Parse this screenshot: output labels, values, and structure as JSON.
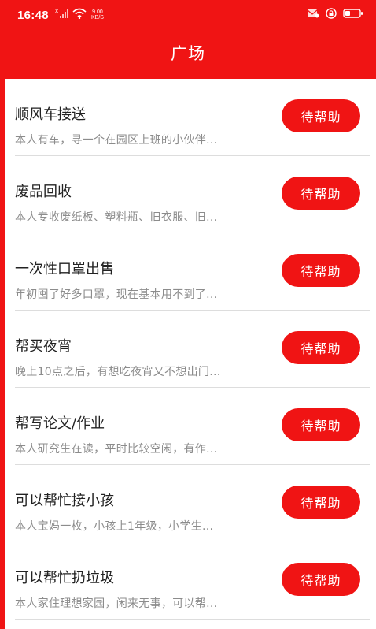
{
  "status_bar": {
    "time": "16:48",
    "net_speed_value": "9.00",
    "net_speed_unit": "KB/S",
    "icons": [
      "no-signal-icon",
      "wifi-icon",
      "mail-icon",
      "lock-icon",
      "battery-icon"
    ]
  },
  "header": {
    "title": "广场"
  },
  "colors": {
    "accent": "#f01414",
    "divider": "#dddddd",
    "title_text": "#222222",
    "desc_text": "#8c8c8c"
  },
  "items": [
    {
      "title": "顺风车接送",
      "desc": "本人有车，寻一个在园区上班的小伙伴...",
      "button": "待帮助"
    },
    {
      "title": "废品回收",
      "desc": "本人专收废纸板、塑料瓶、旧衣服、旧...",
      "button": "待帮助"
    },
    {
      "title": "一次性口罩出售",
      "desc": "年初囤了好多口罩，现在基本用不到了...",
      "button": "待帮助"
    },
    {
      "title": "帮买夜宵",
      "desc": "晚上10点之后，有想吃夜宵又不想出门...",
      "button": "待帮助"
    },
    {
      "title": "帮写论文/作业",
      "desc": "本人研究生在读，平时比较空闲，有作...",
      "button": "待帮助"
    },
    {
      "title": "可以帮忙接小孩",
      "desc": "本人宝妈一枚，小孩上1年级，小学生...",
      "button": "待帮助"
    },
    {
      "title": "可以帮忙扔垃圾",
      "desc": "本人家住理想家园，闲来无事，可以帮...",
      "button": "待帮助"
    }
  ]
}
